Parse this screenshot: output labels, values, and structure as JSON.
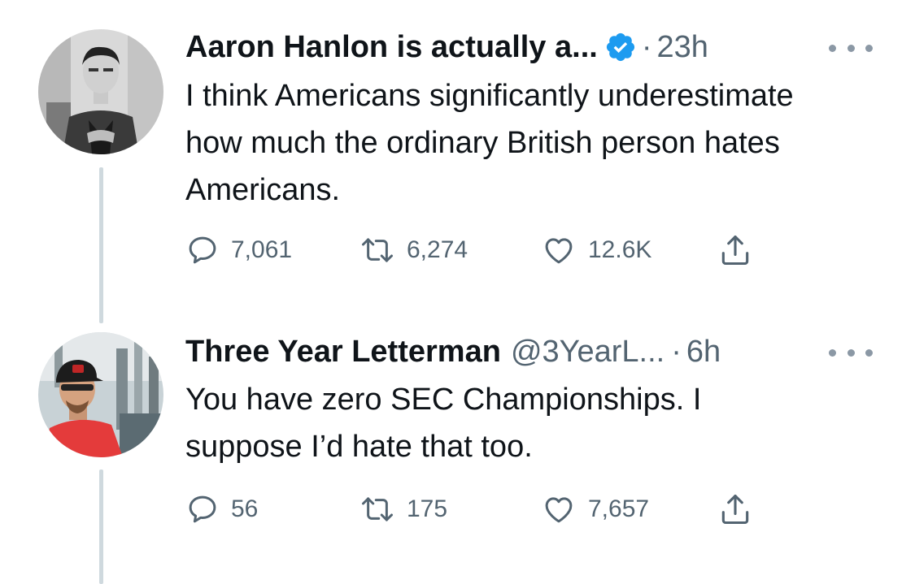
{
  "tweets": [
    {
      "display_name": "Aaron Hanlon is actually a...",
      "handle": "",
      "separator": "·",
      "time": "23h",
      "verified": true,
      "text": "I think Americans significantly underestimate how much the ordinary British person hates Americans.",
      "replies": "7,061",
      "retweets": "6,274",
      "likes": "12.6K"
    },
    {
      "display_name": "Three Year Letterman",
      "handle": "@3YearL...",
      "separator": "·",
      "time": "6h",
      "verified": false,
      "text": "You have zero SEC Championships. I suppose I’d hate that too.",
      "replies": "56",
      "retweets": "175",
      "likes": "7,657"
    }
  ],
  "colors": {
    "text": "#0f1419",
    "secondary": "#536471",
    "verified_blue": "#1d9bf0",
    "thread_line": "#cfd9de"
  },
  "icons": [
    "reply-icon",
    "retweet-icon",
    "like-icon",
    "share-icon",
    "verified-badge-icon",
    "more-icon"
  ]
}
